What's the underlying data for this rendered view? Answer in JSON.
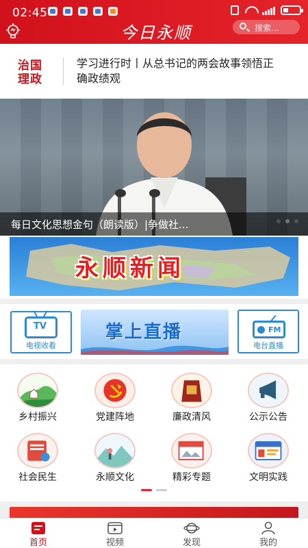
{
  "status_bar": {
    "time": "02:45"
  },
  "header": {
    "logo_text": "今日永顺",
    "search_placeholder": "搜索..."
  },
  "headline": {
    "tag": "治国理政",
    "text": "学习进行时丨从总书记的两会故事领悟正确政绩观"
  },
  "banner": {
    "caption": "每日文化思想金句（朗读版）|争做社...",
    "slide_count": 3,
    "active_slide": 2
  },
  "news_banner": {
    "title": "永顺新闻"
  },
  "media": {
    "tv_label": "电视收看",
    "tv_icon_text": "TV",
    "live_title": "掌上直播",
    "fm_label": "电台直播",
    "fm_icon_text": "FM"
  },
  "grid": {
    "items": [
      {
        "label": "乡村振兴",
        "icon": "village-icon"
      },
      {
        "label": "党建阵地",
        "icon": "party-emblem-icon"
      },
      {
        "label": "廉政清风",
        "icon": "integrity-icon"
      },
      {
        "label": "公示公告",
        "icon": "megaphone-icon"
      },
      {
        "label": "社会民生",
        "icon": "livelihood-icon"
      },
      {
        "label": "永顺文化",
        "icon": "culture-icon"
      },
      {
        "label": "精彩专题",
        "icon": "special-topic-icon"
      },
      {
        "label": "文明实践",
        "icon": "civilization-icon"
      }
    ],
    "page_count": 2,
    "active_page": 1
  },
  "tabbar": {
    "tabs": [
      {
        "label": "首页",
        "icon": "home-icon",
        "active": true
      },
      {
        "label": "视频",
        "icon": "video-icon",
        "active": false
      },
      {
        "label": "发现",
        "icon": "discover-icon",
        "active": false
      },
      {
        "label": "我的",
        "icon": "profile-icon",
        "active": false
      }
    ]
  },
  "colors": {
    "brand_red": "#d1111b",
    "accent_blue": "#2a8bd4"
  }
}
